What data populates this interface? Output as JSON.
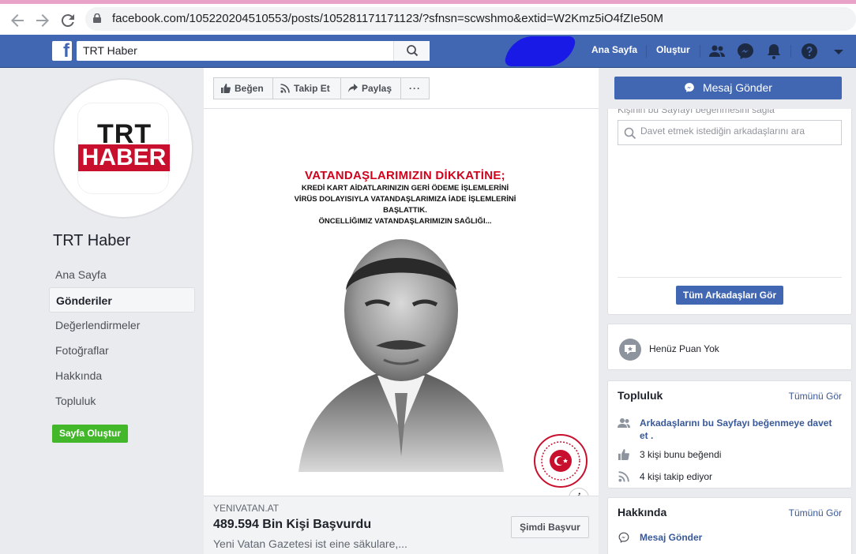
{
  "browser": {
    "url": "facebook.com/105220204510553/posts/105281171171123/?sfnsn=scwshmo&extid=W2Kmz5iO4fZIe50M"
  },
  "fb_bar": {
    "search_value": "TRT Haber",
    "home_label": "Ana Sayfa",
    "create_label": "Oluştur"
  },
  "profile": {
    "logo_top": "TRT",
    "logo_bottom": "HABER",
    "page_name": "TRT Haber"
  },
  "left_nav": {
    "items": [
      "Ana Sayfa",
      "Gönderiler",
      "Değerlendirmeler",
      "Fotoğraflar",
      "Hakkında",
      "Topluluk"
    ],
    "create_page": "Sayfa Oluştur"
  },
  "actions": {
    "like": "Beğen",
    "follow": "Takip Et",
    "share": "Paylaş",
    "more": "···"
  },
  "post": {
    "headline": "VATANDAŞLARIMIZIN DİKKATİNE;",
    "body_lines": [
      "KREDİ KART AİDATLARINIZIN GERİ ÖDEME İŞLEMLERİNİ",
      "VİRÜS DOLAYISIYLA VATANDAŞLARIMIZA İADE İŞLEMLERİNİ",
      "BAŞLATTIK.",
      "ÖNCELLİĞIMIZ VATANDAŞLARIMIZIN SAĞLIĞI..."
    ],
    "info_icon": "i",
    "link_domain": "YENIVATAN.AT",
    "link_title": "489.594 Bin Kişi Başvurdu",
    "link_desc": "Yeni Vatan Gazetesi ist eine säkulare,...",
    "apply_button": "Şimdi Başvur"
  },
  "right": {
    "message_button": "Mesaj Gönder",
    "invite_cut_text": "Kişinin bu Sayfayı beğenmesini sağla",
    "invite_placeholder": "Davet etmek istediğin arkadaşlarını ara",
    "see_all_friends": "Tüm Arkadaşları Gör",
    "rating_text": "Henüz Puan Yok",
    "community": {
      "title": "Topluluk",
      "see_all": "Tümünü Gör",
      "invite_link": "Arkadaşlarını bu Sayfayı beğenmeye davet et .",
      "likes": "3 kişi bunu beğendi",
      "follows": "4 kişi takip ediyor"
    },
    "about": {
      "title": "Hakkında",
      "see_all": "Tümünü Gör",
      "send_message": "Mesaj Gönder"
    }
  },
  "colors": {
    "fb_blue": "#4267b2",
    "green": "#42b72a",
    "link": "#385898",
    "trt_red": "#c8102e"
  }
}
